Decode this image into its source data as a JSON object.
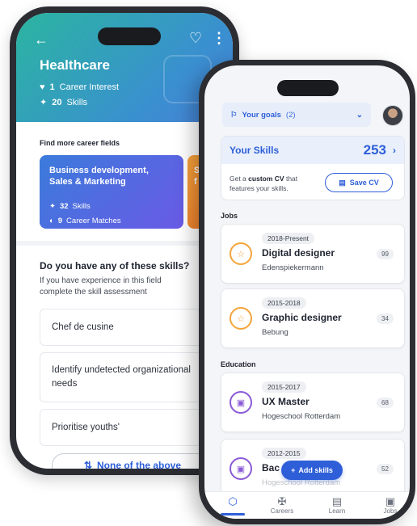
{
  "left_phone": {
    "title": "Healthcare",
    "career_interest_count": "1",
    "career_interest_label": "Career Interest",
    "skills_count": "20",
    "skills_label": "Skills",
    "find_more_label": "Find more career fields",
    "field_card": {
      "title": "Business development, Sales & Marketing",
      "skills_count": "32",
      "skills_label": "Skills",
      "matches_count": "9",
      "matches_label": "Career Matches"
    },
    "field_card_partial": "S\nf",
    "question_title": "Do you have any of these skills?",
    "question_subtitle": "If you have experience in this field complete the skill assessment",
    "skills": [
      "Chef de cusine",
      "Identify undetected organizational needs",
      "Prioritise youths'"
    ],
    "none_button": "None of the above"
  },
  "right_phone": {
    "goals_label": "Your goals",
    "goals_count": "(2)",
    "your_skills_label": "Your Skills",
    "your_skills_count": "253",
    "cv_prefix": "Get a",
    "cv_bold": "custom CV",
    "cv_suffix": "that features your skills.",
    "save_cv": "Save CV",
    "jobs_label": "Jobs",
    "education_label": "Education",
    "jobs": [
      {
        "date": "2018-Present",
        "title": "Digital designer",
        "org": "Edenspiekermann",
        "count": "99"
      },
      {
        "date": "2015-2018",
        "title": "Graphic designer",
        "org": "Bebung",
        "count": "34"
      }
    ],
    "education": [
      {
        "date": "2015-2017",
        "title": "UX Master",
        "org": "Hogeschool Rotterdam",
        "count": "68"
      },
      {
        "date": "2012-2015",
        "title": "Bac",
        "org": "Hogeschool Rotterdam",
        "count": "52"
      }
    ],
    "add_skills": "Add skills",
    "nav": {
      "careers": "Careers",
      "learn": "Learn",
      "jobs": "Jobs"
    }
  },
  "colors": {
    "accent_blue": "#2e5fd8",
    "job_icon_orange": "#f4a53a",
    "edu_icon_purple": "#8a5ad6",
    "header_teal": "#2bb5a0"
  }
}
